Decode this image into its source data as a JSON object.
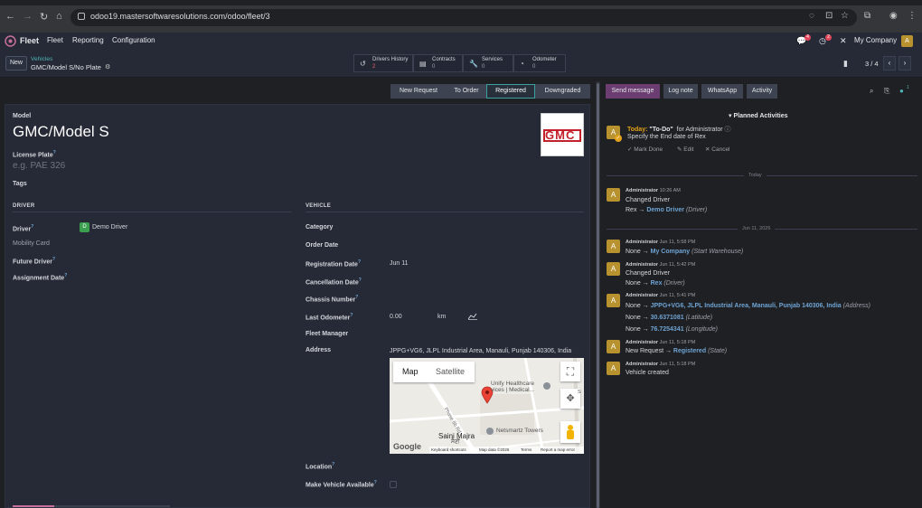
{
  "browser": {
    "url": "odoo19.mastersoftwaresolutions.com/odoo/fleet/3"
  },
  "nav": {
    "app": "Fleet",
    "menus": [
      "Fleet",
      "Reporting",
      "Configuration"
    ],
    "chat_count": "4",
    "activity_count": "2",
    "company": "My Company",
    "user_initial": "A"
  },
  "control": {
    "new_label": "New",
    "breadcrumb_parent": "Vehicles",
    "record_title": "GMC/Model S/No Plate",
    "pager": "3 / 4",
    "smart_buttons": [
      {
        "label": "Drivers History",
        "value": "2",
        "icon": "history-icon"
      },
      {
        "label": "Contracts",
        "value": "0",
        "icon": "contract-icon"
      },
      {
        "label": "Services",
        "value": "0",
        "icon": "wrench-icon"
      },
      {
        "label": "Odometer",
        "value": "0",
        "icon": "tachometer-icon"
      }
    ]
  },
  "stages": [
    "New Request",
    "To Order",
    "Registered",
    "Downgraded"
  ],
  "active_stage": "Registered",
  "form": {
    "model_label": "Model",
    "model_value": "GMC/Model S",
    "plate_label": "License Plate",
    "plate_placeholder": "e.g. PAE 326",
    "tags_label": "Tags",
    "logo_text": "GMC",
    "driver_section": "DRIVER",
    "vehicle_section": "VEHICLE",
    "driver": {
      "driver_label": "Driver",
      "driver_value": "Demo Driver",
      "driver_initial": "D",
      "mobility_label": "Mobility Card",
      "future_label": "Future Driver",
      "assignment_label": "Assignment Date"
    },
    "vehicle": {
      "category_label": "Category",
      "order_label": "Order Date",
      "registration_label": "Registration Date",
      "registration_value": "Jun 11",
      "cancellation_label": "Cancellation Date",
      "chassis_label": "Chassis Number",
      "odometer_label": "Last Odometer",
      "odometer_value": "0.00",
      "odometer_unit": "km",
      "manager_label": "Fleet Manager",
      "address_label": "Address",
      "address_value": "JPPG+VG6, JLPL Industrial Area, Manauli, Punjab 140306, India",
      "location_label": "Location",
      "available_label": "Make Vehicle Available"
    },
    "map": {
      "tab_map": "Map",
      "tab_satellite": "Satellite",
      "place_1": "Unify Healthcare",
      "place_1b": "vices | Medical...",
      "place_2": "Netsmartz Towers",
      "place_3": "Saini Majra",
      "place_3b": "ਸੈਣੀ",
      "road": "Phase 8b Rd",
      "google": "Google",
      "footer_1": "Keyboard shortcuts",
      "footer_2": "Map data ©2026",
      "footer_3": "Terms",
      "footer_4": "Report a map error",
      "edge_label": "S"
    }
  },
  "chatter": {
    "buttons": [
      "Send message",
      "Log note",
      "WhatsApp",
      "Activity"
    ],
    "follower_count": "1",
    "planned_title": "Planned Activities",
    "activity": {
      "when": "Today:",
      "title": "\"To-Do\"",
      "for_text": "for Administrator",
      "desc": "Specify the End date of Rex",
      "mark_done": "Mark Done",
      "edit": "Edit",
      "cancel": "Cancel"
    },
    "day_today": "Today",
    "day_date": "Jun 11, 2026",
    "messages": [
      {
        "author": "Administrator",
        "time": "10:26 AM",
        "line1": "Changed Driver",
        "old": "Rex",
        "new": "Demo Driver",
        "field": "(Driver)"
      },
      {
        "author": "Administrator",
        "time": "Jun 11, 5:58 PM",
        "old": "None",
        "new": "My Company",
        "field": "(Start Warehouse)"
      },
      {
        "author": "Administrator",
        "time": "Jun 11, 5:42 PM",
        "line1": "Changed Driver",
        "old": "None",
        "new": "Rex",
        "field": "(Driver)"
      },
      {
        "author": "Administrator",
        "time": "Jun 11, 5:41 PM",
        "old": "None",
        "new": "JPPG+VG6, JLPL Industrial Area, Manauli, Punjab 140306, India",
        "field": "(Address)",
        "old2": "None",
        "new2": "30.6371081",
        "field2": "(Latitude)",
        "old3": "None",
        "new3": "76.7254341",
        "field3": "(Longitude)"
      },
      {
        "author": "Administrator",
        "time": "Jun 11, 5:18 PM",
        "old": "New Request",
        "new": "Registered",
        "field": "(State)"
      },
      {
        "author": "Administrator",
        "time": "Jun 11, 5:18 PM",
        "line1": "Vehicle created"
      }
    ]
  }
}
